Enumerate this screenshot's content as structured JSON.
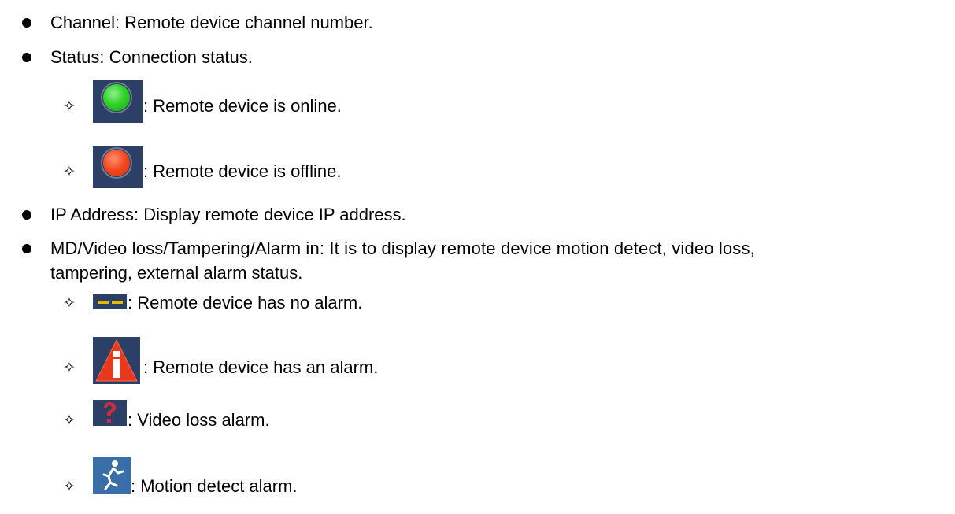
{
  "items": [
    {
      "label": "Channel",
      "text": "Channel: Remote device channel number."
    },
    {
      "label": "Status",
      "text": "Status: Connection status."
    },
    {
      "label": "IP Address",
      "text": "IP Address: Display remote device IP address."
    },
    {
      "label": "MD/Video loss/Tampering/Alarm in",
      "text_line1": "MD/Video loss/Tampering/Alarm in: It is to display remote device motion detect, video loss,",
      "text_line2": "tampering, external alarm status."
    }
  ],
  "status_states": [
    {
      "icon": "green-circle-icon",
      "color": "#33d22a",
      "text": ": Remote device is online."
    },
    {
      "icon": "red-circle-icon",
      "color": "#f2461f",
      "text": ": Remote device is offline."
    }
  ],
  "alarm_states": [
    {
      "icon": "no-alarm-dashes-icon",
      "color": "#e6b800",
      "text": ": Remote device has no alarm."
    },
    {
      "icon": "alarm-warning-icon",
      "color": "#e8391e",
      "text": ": Remote device has an alarm."
    },
    {
      "icon": "video-loss-question-icon",
      "color": "#b3303a",
      "text": ": Video loss alarm."
    },
    {
      "icon": "motion-detect-runner-icon",
      "color": "#3a6ea8",
      "text": ": Motion detect alarm."
    }
  ],
  "sub_bullet_symbol": "✧"
}
